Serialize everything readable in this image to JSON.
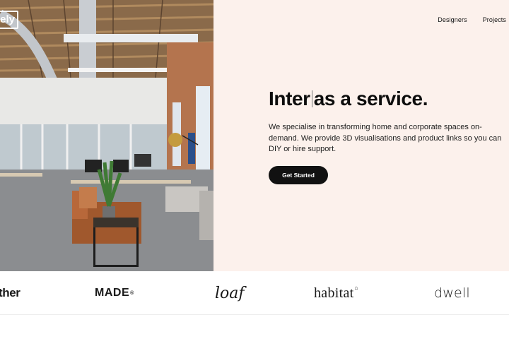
{
  "brand": {
    "logo_text": "ely"
  },
  "nav": {
    "items": [
      {
        "label": "Designers"
      },
      {
        "label": "Projects"
      }
    ]
  },
  "hero": {
    "headline_before_cursor": "Inter",
    "headline_after_cursor": "as a service.",
    "description": "We specialise in transforming home and corporate spaces on-demand. We provide 3D visualisations and product links so you can DIY or hire support.",
    "cta_label": "Get Started"
  },
  "brands": [
    {
      "name": "ther"
    },
    {
      "name": "MADE",
      "mark": "®"
    },
    {
      "name": "loaf"
    },
    {
      "name": "habitat",
      "mark": "⌂"
    },
    {
      "name": "dwell"
    }
  ],
  "colors": {
    "panel_bg": "#fcf1ec",
    "cta_bg": "#111111",
    "cta_text": "#ffffff"
  }
}
